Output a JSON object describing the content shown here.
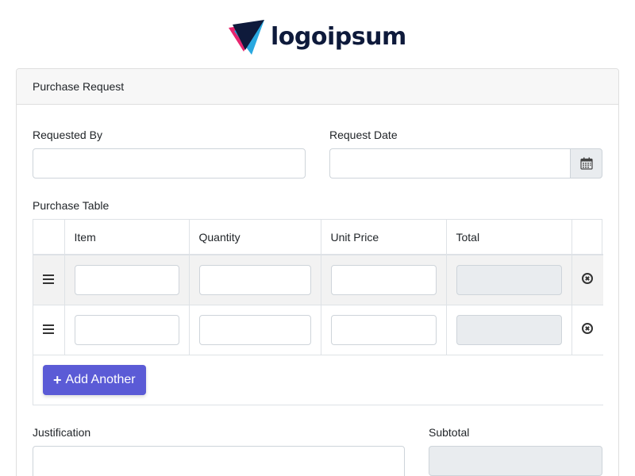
{
  "logo": {
    "text": "logoipsum"
  },
  "card": {
    "title": "Purchase Request"
  },
  "fields": {
    "requested_by": {
      "label": "Requested By",
      "value": ""
    },
    "request_date": {
      "label": "Request Date",
      "value": ""
    }
  },
  "purchase_table": {
    "label": "Purchase Table",
    "columns": [
      "Item",
      "Quantity",
      "Unit Price",
      "Total"
    ],
    "rows": [
      {
        "item": "",
        "quantity": "",
        "unit_price": "",
        "total": ""
      },
      {
        "item": "",
        "quantity": "",
        "unit_price": "",
        "total": ""
      }
    ],
    "add_button_label": "Add Another"
  },
  "justification": {
    "label": "Justification",
    "value": ""
  },
  "subtotal": {
    "label": "Subtotal",
    "value": ""
  },
  "colors": {
    "accent": "#5b5bd6",
    "logo_text": "#0e1a3b",
    "logo_pink": "#e7256e",
    "logo_cyan": "#29a8e0",
    "logo_navy": "#0e1a3b"
  }
}
